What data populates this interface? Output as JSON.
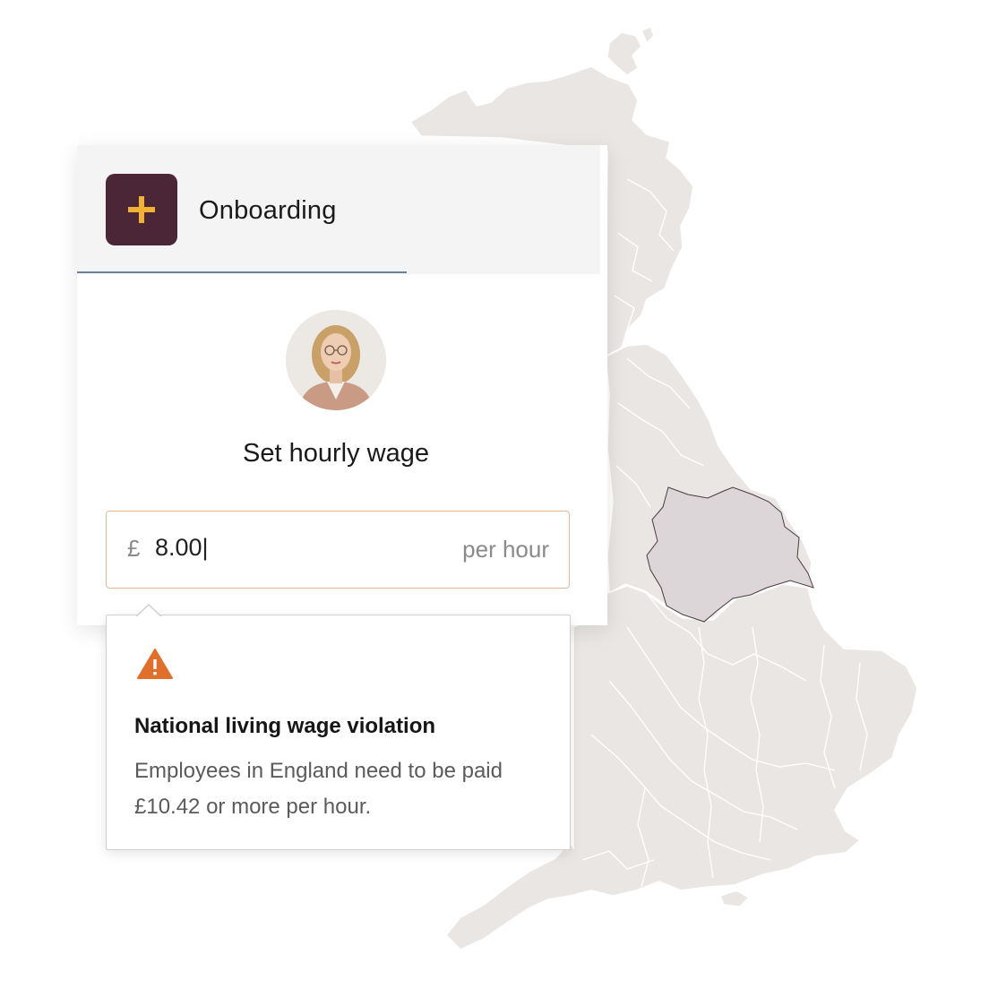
{
  "map": {
    "highlighted_region": "Yorkshire and the Humber",
    "land_color": "#e9e6e3",
    "border_color": "#ffffff",
    "highlight_color": "#dcd6d8"
  },
  "card": {
    "header": {
      "icon": "plus-icon",
      "title": "Onboarding"
    },
    "avatar_icon": "employee-avatar",
    "section_title": "Set hourly wage",
    "wage_field": {
      "currency_symbol": "£",
      "value": "8.00|",
      "unit": "per hour"
    }
  },
  "alert": {
    "icon": "warning-icon",
    "title": "National living wage violation",
    "message": "Employees in England need to be paid £10.42 or more per hour."
  },
  "colors": {
    "brand": "#4a2637",
    "icon_accent": "#f2b133",
    "warning": "#e06f2c",
    "field_border": "#e8b692"
  }
}
